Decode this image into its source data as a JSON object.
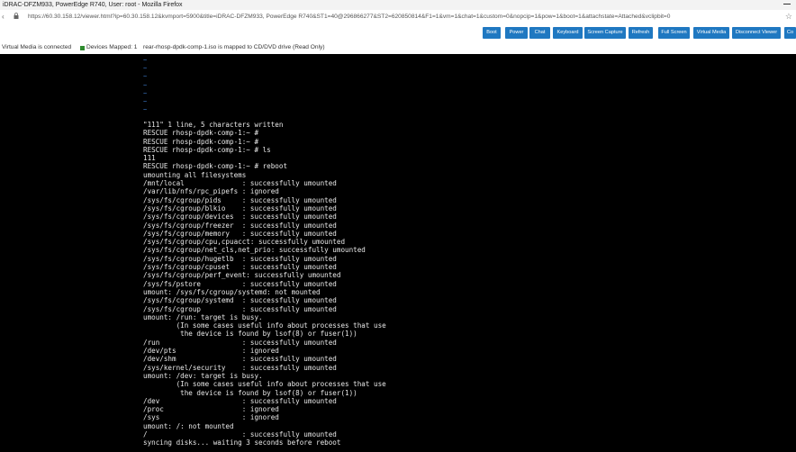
{
  "window": {
    "title": "iDRAC-DFZM933, PowerEdge R740, User: root - Mozilla Firefox"
  },
  "address_bar": {
    "url": "https://60.30.158.12/viewer.html?ip=60.30.158.12&kvmport=5900&title=iDRAC-DFZM933, PowerEdge R740&ST1=40@296866277&ST2=620850814&F1=1&vm=1&chat=1&custom=0&nopcip=1&pow=1&boot=1&attachstate=Attached&vclipbit=0"
  },
  "toolbar": {
    "buttons": [
      "Boot",
      "Power",
      "Chat",
      "Keyboard",
      "Screen Capture",
      "Refresh",
      "Full Screen",
      "Virtual Media",
      "Disconnect Viewer",
      "Co"
    ]
  },
  "status": {
    "virtual_media": "Virtual Media is connected",
    "devices_mapped": "Devices Mapped: 1",
    "mapped_info": "rear-rhosp-dpdk-comp-1.iso is mapped to CD/DVD drive (Read Only)"
  },
  "console": {
    "tilde": "~",
    "lines": [
      "\"111\" 1 line, 5 characters written",
      "RESCUE rhosp-dpdk-comp-1:~ #",
      "RESCUE rhosp-dpdk-comp-1:~ #",
      "RESCUE rhosp-dpdk-comp-1:~ # ls",
      "111",
      "RESCUE rhosp-dpdk-comp-1:~ # reboot",
      "umounting all filesystems",
      "/mnt/local              : successfully umounted",
      "/var/lib/nfs/rpc_pipefs : ignored",
      "/sys/fs/cgroup/pids     : successfully umounted",
      "/sys/fs/cgroup/blkio    : successfully umounted",
      "/sys/fs/cgroup/devices  : successfully umounted",
      "/sys/fs/cgroup/freezer  : successfully umounted",
      "/sys/fs/cgroup/memory   : successfully umounted",
      "/sys/fs/cgroup/cpu,cpuacct: successfully umounted",
      "/sys/fs/cgroup/net_cls,net_prio: successfully umounted",
      "/sys/fs/cgroup/hugetlb  : successfully umounted",
      "/sys/fs/cgroup/cpuset   : successfully umounted",
      "/sys/fs/cgroup/perf_event: successfully umounted",
      "/sys/fs/pstore          : successfully umounted",
      "umount: /sys/fs/cgroup/systemd: not mounted",
      "/sys/fs/cgroup/systemd  : successfully umounted",
      "/sys/fs/cgroup          : successfully umounted",
      "umount: /run: target is busy.",
      "        (In some cases useful info about processes that use",
      "         the device is found by lsof(8) or fuser(1))",
      "/run                    : successfully umounted",
      "/dev/pts                : ignored",
      "/dev/shm                : successfully umounted",
      "/sys/kernel/security    : successfully umounted",
      "umount: /dev: target is busy.",
      "        (In some cases useful info about processes that use",
      "         the device is found by lsof(8) or fuser(1))",
      "/dev                    : successfully umounted",
      "/proc                   : ignored",
      "/sys                    : ignored",
      "umount: /: not mounted",
      "/                       : successfully umounted",
      "syncing disks... waiting 3 seconds before reboot"
    ]
  },
  "colors": {
    "button_bg": "#1f78c1",
    "console_bg": "#000000",
    "console_text": "#e8e8e8",
    "tilde": "#3b78c8",
    "status_dot": "#2e8b2e"
  }
}
